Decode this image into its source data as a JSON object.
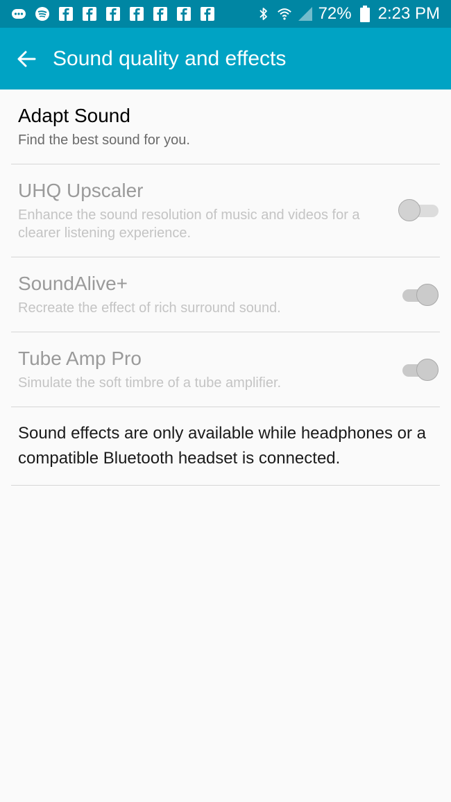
{
  "status_bar": {
    "notification_icons": [
      "messages-icon",
      "spotify-icon",
      "facebook-icon",
      "facebook-icon",
      "facebook-icon",
      "facebook-icon",
      "facebook-icon",
      "facebook-icon",
      "facebook-icon"
    ],
    "battery": "72%",
    "time": "2:23 PM"
  },
  "app_bar": {
    "title": "Sound quality and effects"
  },
  "settings": [
    {
      "title": "Adapt Sound",
      "subtitle": "Find the best sound for you.",
      "enabled": true
    },
    {
      "title": "UHQ Upscaler",
      "subtitle": "Enhance the sound resolution of music and videos for a clearer listening experience.",
      "enabled": false,
      "toggle": "off"
    },
    {
      "title": "SoundAlive+",
      "subtitle": "Recreate the effect of rich surround sound.",
      "enabled": false,
      "toggle": "on"
    },
    {
      "title": "Tube Amp Pro",
      "subtitle": "Simulate the soft timbre of a tube amplifier.",
      "enabled": false,
      "toggle": "on"
    }
  ],
  "note": "Sound effects are only available while headphones or a compatible Bluetooth headset is connected.",
  "colors": {
    "status_bar": "#0086a3",
    "app_bar": "#00a3c4",
    "background": "#fafafa"
  }
}
